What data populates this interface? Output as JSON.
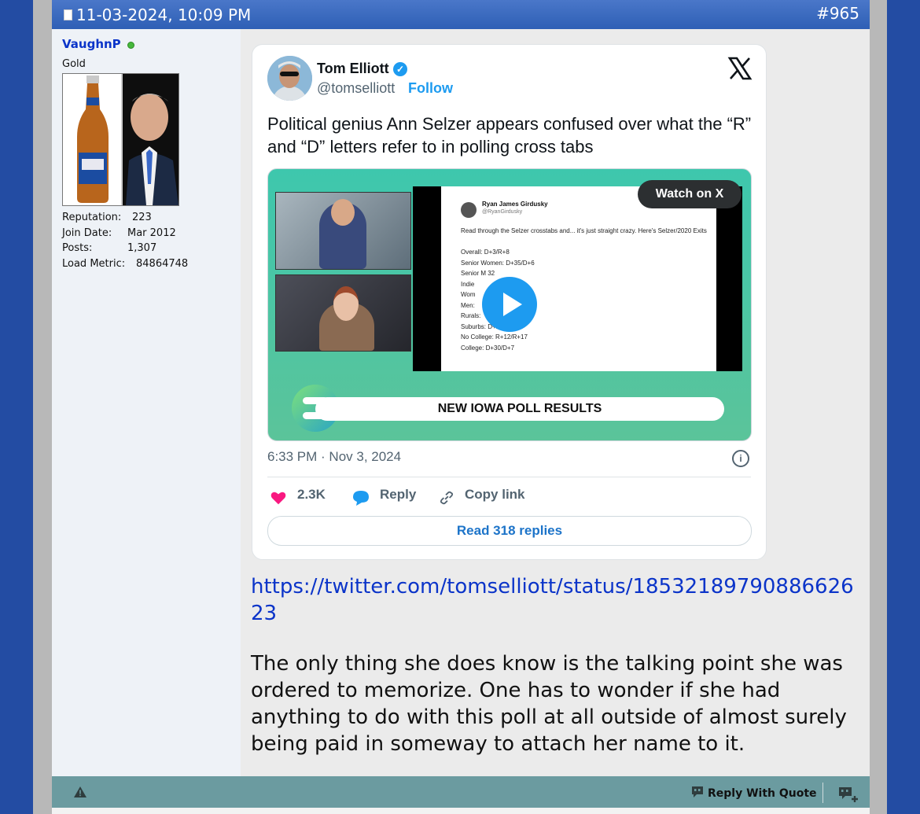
{
  "post": {
    "date": "11-03-2024, 10:09 PM",
    "number": "#965"
  },
  "user": {
    "name": "VaughnP",
    "title": "Gold",
    "stats": [
      {
        "label": "Reputation:",
        "value": "223"
      },
      {
        "label": "Join Date:",
        "value": "Mar 2012"
      },
      {
        "label": "Posts:",
        "value": "1,307"
      },
      {
        "label": "Load Metric:",
        "value": "84864748"
      }
    ]
  },
  "tweet": {
    "name": "Tom Elliott",
    "handle": "@tomselliott",
    "follow": "Follow",
    "text": "Political genius Ann Selzer appears confused over what the “R” and “D” letters refer to in polling cross tabs",
    "media": {
      "watch_label": "Watch on X",
      "banner": "NEW IOWA POLL RESULTS",
      "inner_name": "Ryan James Girdusky",
      "inner_handle": "@RyanGirdusky",
      "inner_text": "Read through the Selzer crosstabs and... it's just straight crazy. Here's Selzer/2020 Exits\n\nOverall: D+3/R+8\nSenior Women: D+35/D+6\nSenior M      32\nIndie\nWom\nMen:\nRurals:\nSuburbs: D+23/R+3\nNo College: R+12/R+17\nCollege: D+30/D+7"
    },
    "time": "6:33 PM · Nov 3, 2024",
    "likes": "2.3K",
    "reply": "Reply",
    "copy_link": "Copy link",
    "read_replies": "Read 318 replies"
  },
  "link": "https://twitter.com/tomselliott/status/1853218979088662623",
  "body": "The only thing she does know is the talking point she was ordered to memorize. One has to wonder if she had anything to do with this poll at all outside of almost surely being paid in someway to attach her name to it.",
  "footer": {
    "reply_with_quote": "Reply With Quote"
  },
  "colors": {
    "page_bg": "#234ca3",
    "header_bg": "#2e5fb5",
    "footer_bg": "#6b9ba0",
    "link": "#0b34c9",
    "twitter_blue": "#1d9bf0"
  }
}
